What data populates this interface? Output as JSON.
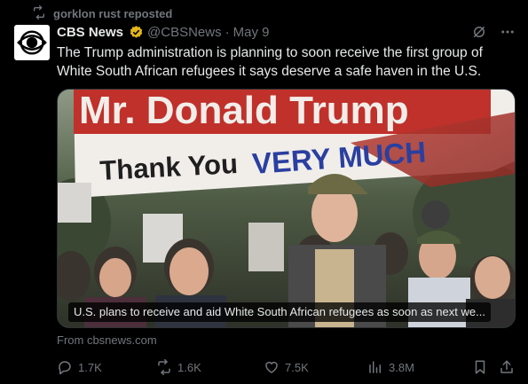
{
  "repost": {
    "text": "gorklon rust reposted",
    "icon": "repost-icon"
  },
  "post": {
    "author_name": "CBS News",
    "handle": "@CBSNews",
    "separator": "·",
    "date": "May 9",
    "text": "The Trump administration is planning to soon receive the first group of White South African refugees  it says deserve a safe haven in the U.S.",
    "avatar_icon": "cbs-eye-logo",
    "verified_icon": "gold-verified-badge"
  },
  "media": {
    "sign_line1": "Mr. Donald Trump",
    "sign_line2_a": "Thank You",
    "sign_line2_b": "VERY MUCH",
    "caption": "U.S. plans to receive and aid White South African refugees as soon as next we..."
  },
  "link_source": "From cbsnews.com",
  "actions": {
    "replies": "1.7K",
    "reposts": "1.6K",
    "likes": "7.5K",
    "views": "3.8M"
  },
  "colors": {
    "background": "#000000",
    "text": "#e7e9ea",
    "muted": "#71767b",
    "verified": "#e2b719"
  }
}
